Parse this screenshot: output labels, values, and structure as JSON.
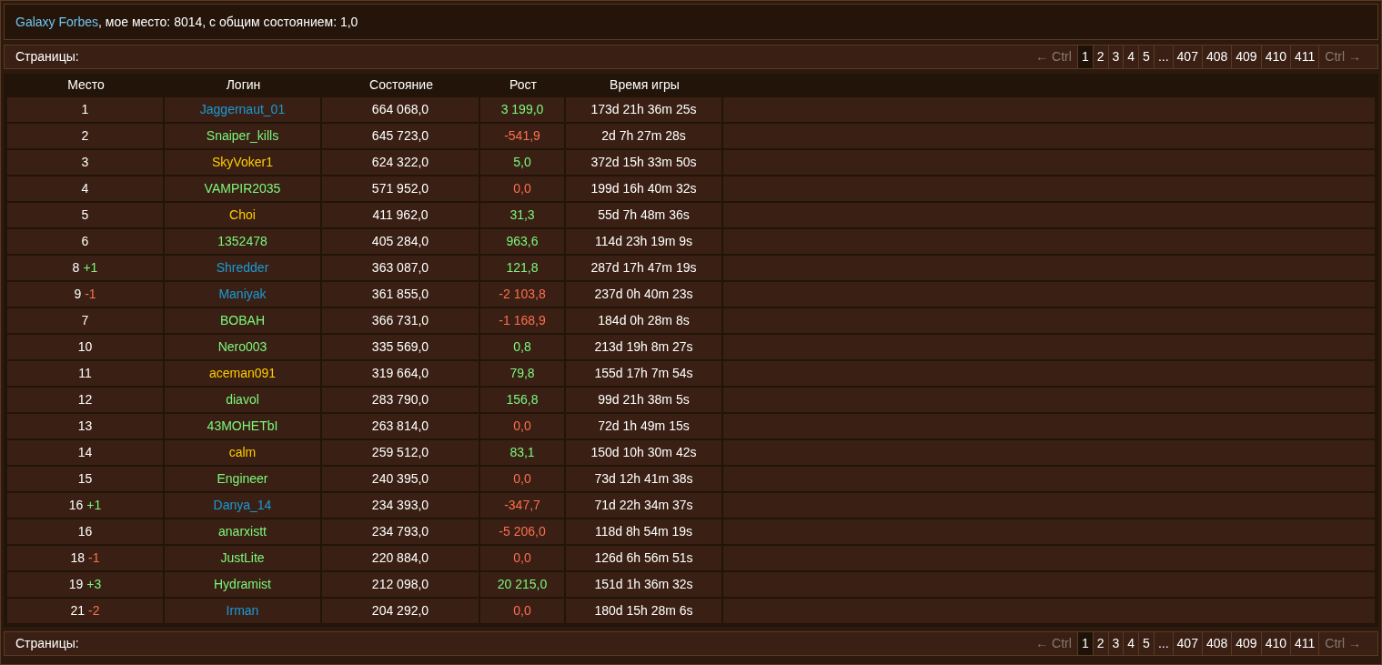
{
  "header": {
    "link": "Galaxy Forbes",
    "text": ", мое место: 8014, с общим состоянием: 1,0"
  },
  "pagination_top": {
    "label": "Страницы:",
    "prev": "← Ctrl",
    "next": "Ctrl →",
    "pages": [
      {
        "label": "1",
        "selected": true
      },
      {
        "label": "2",
        "selected": false
      },
      {
        "label": "3",
        "selected": false
      },
      {
        "label": "4",
        "selected": false
      },
      {
        "label": "5",
        "selected": false
      },
      {
        "label": "...",
        "selected": false
      },
      {
        "label": "407",
        "selected": false
      },
      {
        "label": "408",
        "selected": false
      },
      {
        "label": "409",
        "selected": false
      },
      {
        "label": "410",
        "selected": false
      },
      {
        "label": "411",
        "selected": false
      }
    ]
  },
  "table": {
    "columns": [
      "Место",
      "Логин",
      "Состояние",
      "Рост",
      "Время игры"
    ],
    "rows": [
      {
        "place": "1",
        "change": null,
        "login": {
          "text": "Jaggernaut_01",
          "color": "#1a9bd7"
        },
        "wealth": "664 068,0",
        "growth": {
          "text": "3 199,0",
          "color": "#7cf77c"
        },
        "time": "173d 21h 36m 25s"
      },
      {
        "place": "2",
        "change": null,
        "login": {
          "text": "Snaiper_kills",
          "color": "#7cf77c"
        },
        "wealth": "645 723,0",
        "growth": {
          "text": "-541,9",
          "color": "#ff6e50"
        },
        "time": "2d 7h 27m 28s"
      },
      {
        "place": "3",
        "change": null,
        "login": {
          "text": "SkyVoker1",
          "color": "#ffcc00"
        },
        "wealth": "624 322,0",
        "growth": {
          "text": "5,0",
          "color": "#7cf77c"
        },
        "time": "372d 15h 33m 50s"
      },
      {
        "place": "4",
        "change": null,
        "login": {
          "text": "VAMPIR2035",
          "color": "#7cf77c"
        },
        "wealth": "571 952,0",
        "growth": {
          "text": "0,0",
          "color": "#ff6e50"
        },
        "time": "199d 16h 40m 32s"
      },
      {
        "place": "5",
        "change": null,
        "login": {
          "text": "Choi",
          "color": "#ffcc00"
        },
        "wealth": "411 962,0",
        "growth": {
          "text": "31,3",
          "color": "#7cf77c"
        },
        "time": "55d 7h 48m 36s"
      },
      {
        "place": "6",
        "change": null,
        "login": {
          "text": "1352478",
          "color": "#7cf77c"
        },
        "wealth": "405 284,0",
        "growth": {
          "text": "963,6",
          "color": "#7cf77c"
        },
        "time": "114d 23h 19m 9s"
      },
      {
        "place": "8",
        "change": {
          "text": "+1",
          "color": "#7cf77c"
        },
        "login": {
          "text": "Shredder",
          "color": "#1a9bd7"
        },
        "wealth": "363 087,0",
        "growth": {
          "text": "121,8",
          "color": "#7cf77c"
        },
        "time": "287d 17h 47m 19s"
      },
      {
        "place": "9",
        "change": {
          "text": "-1",
          "color": "#ff6e50"
        },
        "login": {
          "text": "Maniyak",
          "color": "#1a9bd7"
        },
        "wealth": "361 855,0",
        "growth": {
          "text": "-2 103,8",
          "color": "#ff6e50"
        },
        "time": "237d 0h 40m 23s"
      },
      {
        "place": "7",
        "change": null,
        "login": {
          "text": "BOBAH",
          "color": "#7cf77c"
        },
        "wealth": "366 731,0",
        "growth": {
          "text": "-1 168,9",
          "color": "#ff6e50"
        },
        "time": "184d 0h 28m 8s"
      },
      {
        "place": "10",
        "change": null,
        "login": {
          "text": "Nero003",
          "color": "#7cf77c"
        },
        "wealth": "335 569,0",
        "growth": {
          "text": "0,8",
          "color": "#7cf77c"
        },
        "time": "213d 19h 8m 27s"
      },
      {
        "place": "11",
        "change": null,
        "login": {
          "text": "aceman091",
          "color": "#ffcc00"
        },
        "wealth": "319 664,0",
        "growth": {
          "text": "79,8",
          "color": "#7cf77c"
        },
        "time": "155d 17h 7m 54s"
      },
      {
        "place": "12",
        "change": null,
        "login": {
          "text": "diavol",
          "color": "#7cf77c"
        },
        "wealth": "283 790,0",
        "growth": {
          "text": "156,8",
          "color": "#7cf77c"
        },
        "time": "99d 21h 38m 5s"
      },
      {
        "place": "13",
        "change": null,
        "login": {
          "text": "43MOHETbI",
          "color": "#7cf77c"
        },
        "wealth": "263 814,0",
        "growth": {
          "text": "0,0",
          "color": "#ff6e50"
        },
        "time": "72d 1h 49m 15s"
      },
      {
        "place": "14",
        "change": null,
        "login": {
          "text": "calm",
          "color": "#ffcc00"
        },
        "wealth": "259 512,0",
        "growth": {
          "text": "83,1",
          "color": "#7cf77c"
        },
        "time": "150d 10h 30m 42s"
      },
      {
        "place": "15",
        "change": null,
        "login": {
          "text": "Engineer",
          "color": "#7cf77c"
        },
        "wealth": "240 395,0",
        "growth": {
          "text": "0,0",
          "color": "#ff6e50"
        },
        "time": "73d 12h 41m 38s"
      },
      {
        "place": "16",
        "change": {
          "text": "+1",
          "color": "#7cf77c"
        },
        "login": {
          "text": "Danya_14",
          "color": "#1a9bd7"
        },
        "wealth": "234 393,0",
        "growth": {
          "text": "-347,7",
          "color": "#ff6e50"
        },
        "time": "71d 22h 34m 37s"
      },
      {
        "place": "16",
        "change": null,
        "login": {
          "text": "anarxistt",
          "color": "#7cf77c"
        },
        "wealth": "234 793,0",
        "growth": {
          "text": "-5 206,0",
          "color": "#ff6e50"
        },
        "time": "118d 8h 54m 19s"
      },
      {
        "place": "18",
        "change": {
          "text": "-1",
          "color": "#ff6e50"
        },
        "login": {
          "text": "JustLite",
          "color": "#7cf77c"
        },
        "wealth": "220 884,0",
        "growth": {
          "text": "0,0",
          "color": "#ff6e50"
        },
        "time": "126d 6h 56m 51s"
      },
      {
        "place": "19",
        "change": {
          "text": "+3",
          "color": "#7cf77c"
        },
        "login": {
          "text": "Hydramist",
          "color": "#7cf77c"
        },
        "wealth": "212 098,0",
        "growth": {
          "text": "20 215,0",
          "color": "#7cf77c"
        },
        "time": "151d 1h 36m 32s"
      },
      {
        "place": "21",
        "change": {
          "text": "-2",
          "color": "#ff6e50"
        },
        "login": {
          "text": "Irman",
          "color": "#1a9bd7"
        },
        "wealth": "204 292,0",
        "growth": {
          "text": "0,0",
          "color": "#ff6e50"
        },
        "time": "180d 15h 28m 6s"
      }
    ]
  },
  "pagination_bottom": {
    "label": "Страницы:",
    "prev": "← Ctrl",
    "next": "Ctrl →",
    "pages": [
      {
        "label": "1",
        "selected": true
      },
      {
        "label": "2",
        "selected": false
      },
      {
        "label": "3",
        "selected": false
      },
      {
        "label": "4",
        "selected": false
      },
      {
        "label": "5",
        "selected": false
      },
      {
        "label": "...",
        "selected": false
      },
      {
        "label": "407",
        "selected": false
      },
      {
        "label": "408",
        "selected": false
      },
      {
        "label": "409",
        "selected": false
      },
      {
        "label": "410",
        "selected": false
      },
      {
        "label": "411",
        "selected": false
      }
    ]
  }
}
